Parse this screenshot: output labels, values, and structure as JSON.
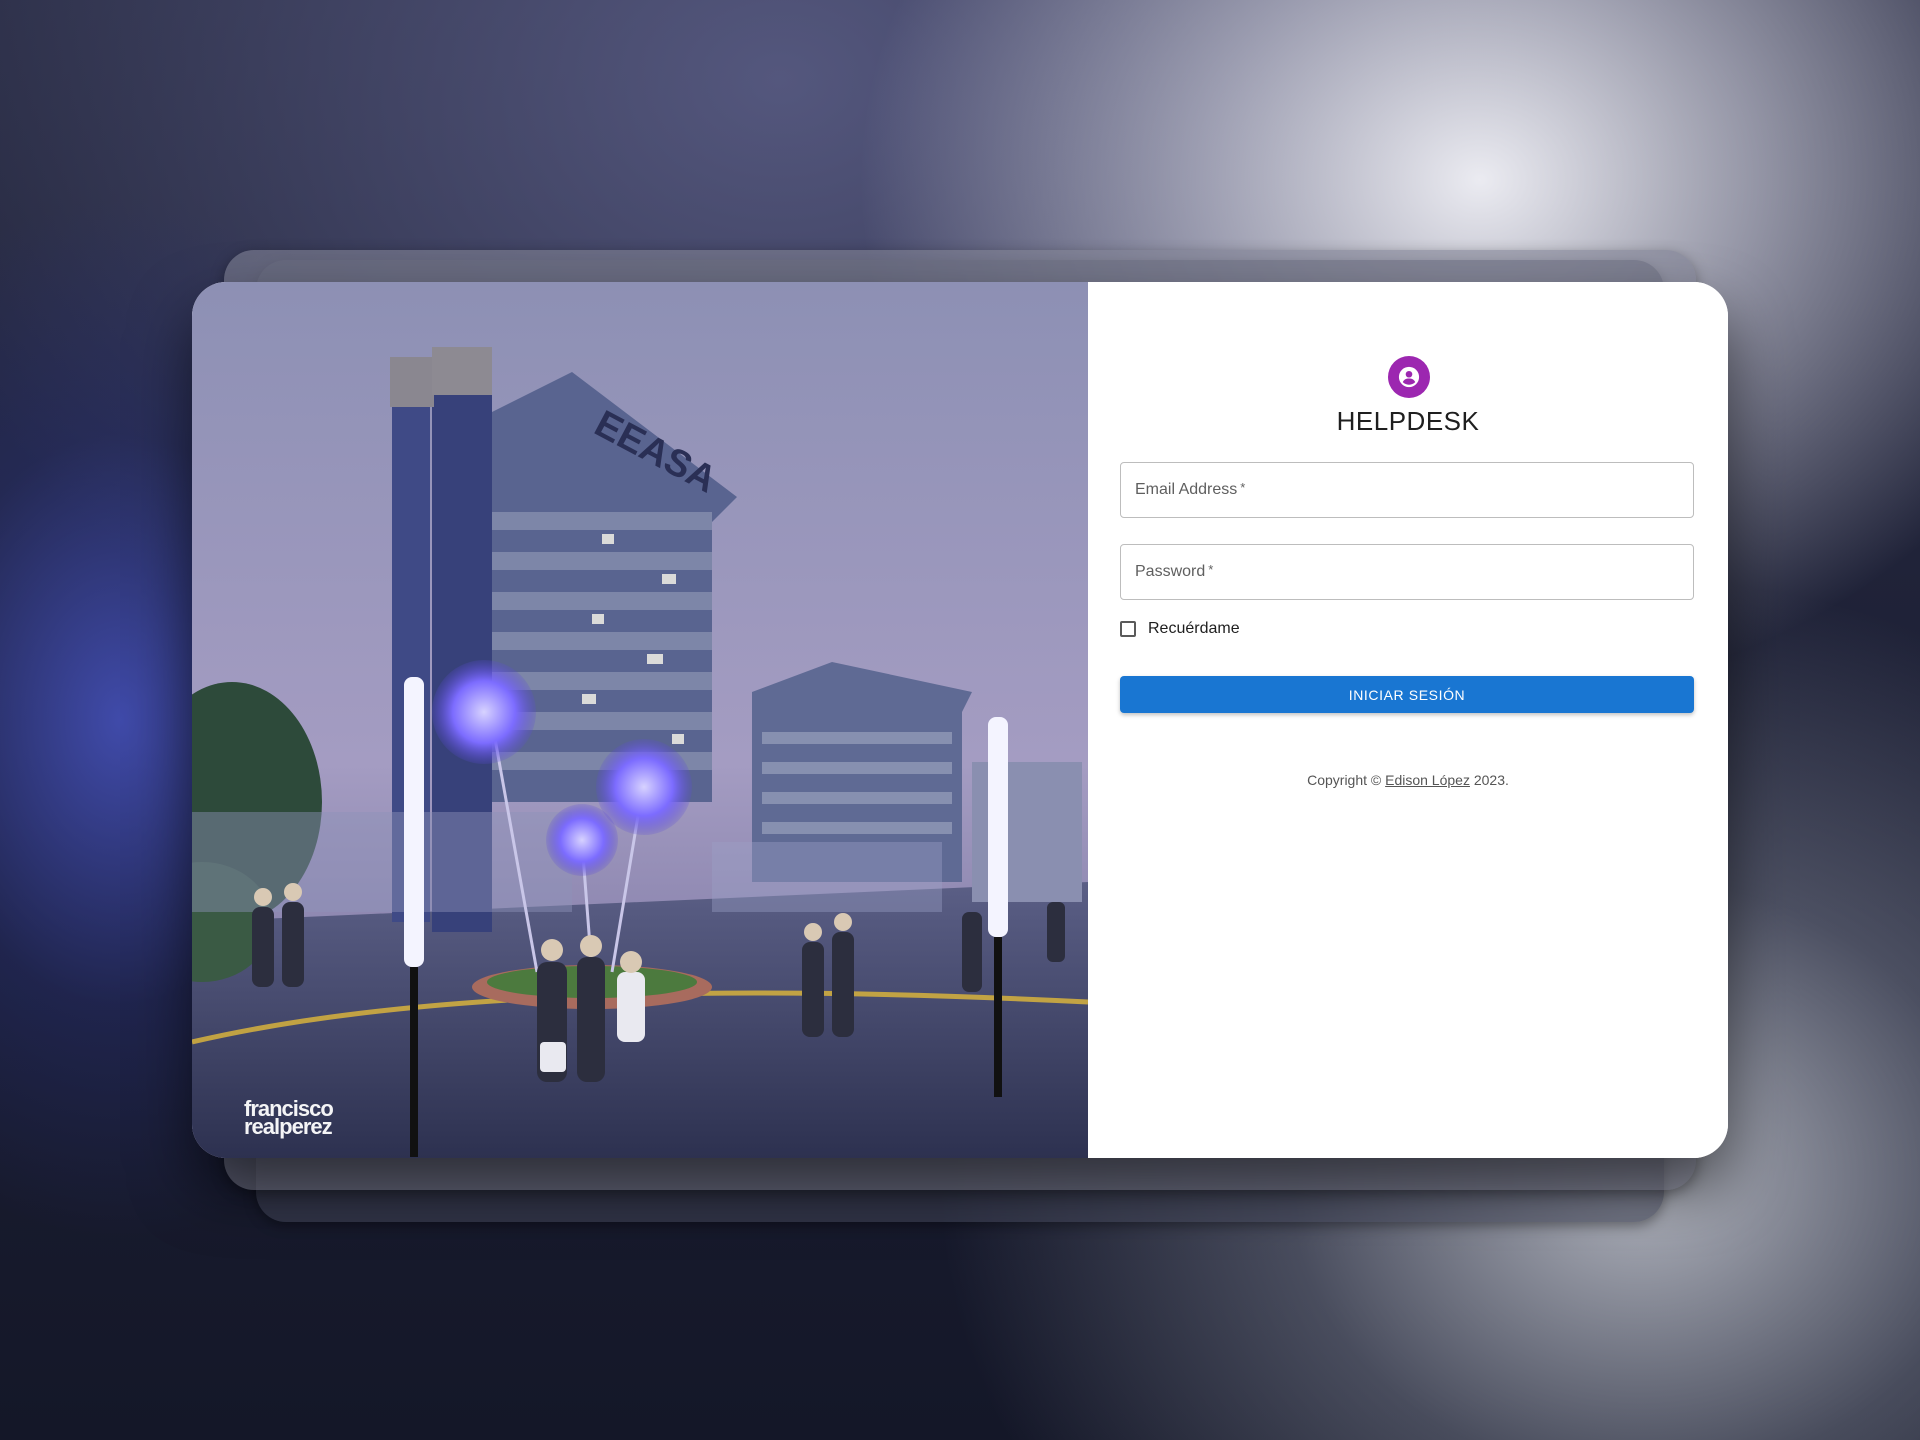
{
  "app": {
    "title": "HELPDESK"
  },
  "hero": {
    "image_description": "",
    "building_sign": "EEASA",
    "watermark_line1": "francisco",
    "watermark_line2": "realperez"
  },
  "form": {
    "email_label": "Email Address",
    "password_label": "Password",
    "required_marker": "*",
    "remember_label": "Recuérdame",
    "remember_checked": false,
    "submit_label": "INICIAR SESIÓN"
  },
  "footer": {
    "copyright_prefix": "Copyright ©",
    "author_link": "Edison López",
    "year_suffix": "2023."
  },
  "colors": {
    "avatar": "#9c27b0",
    "primary_button": "#1976d2"
  },
  "icons": {
    "avatar": "person-icon"
  }
}
